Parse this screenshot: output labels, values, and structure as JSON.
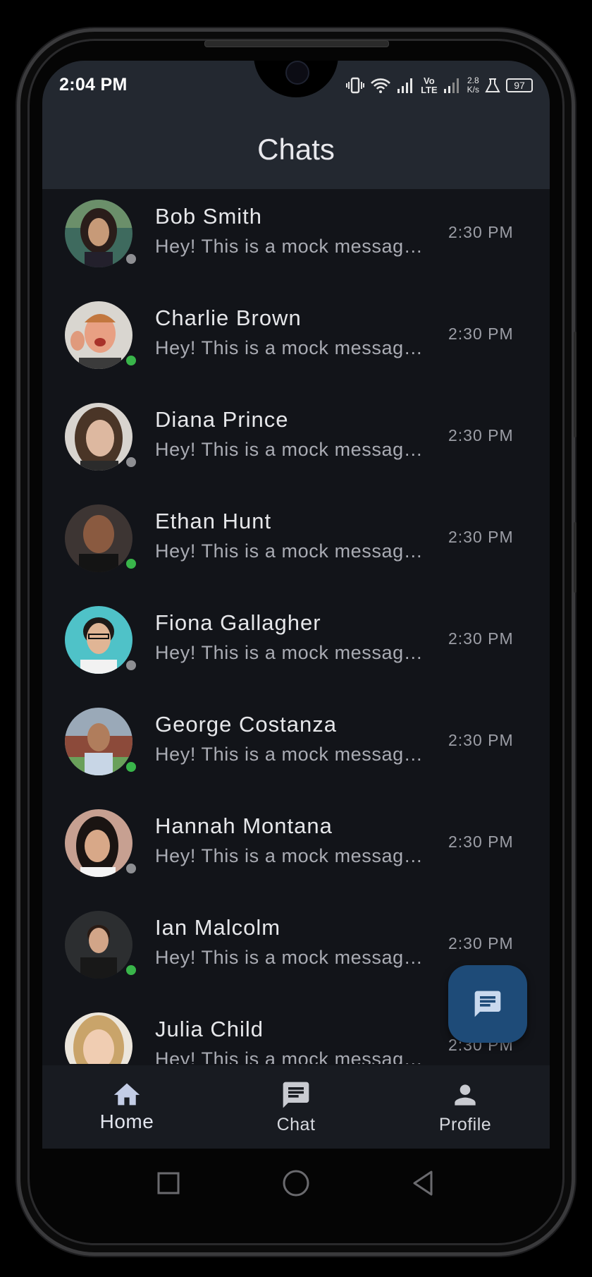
{
  "status_bar": {
    "time": "2:04 PM",
    "net_speed_value": "2.8",
    "net_speed_unit": "K/s",
    "volte_top": "Vo",
    "volte_bottom": "LTE",
    "battery": "97"
  },
  "header": {
    "title": "Chats"
  },
  "chats": [
    {
      "name": "Bob Smith",
      "preview": "Hey! This is a mock message from this user.",
      "time": "2:30 PM",
      "online": false
    },
    {
      "name": "Charlie Brown",
      "preview": "Hey! This is a mock message from this user.",
      "time": "2:30 PM",
      "online": true
    },
    {
      "name": "Diana Prince",
      "preview": "Hey! This is a mock message from this user.",
      "time": "2:30 PM",
      "online": false
    },
    {
      "name": "Ethan Hunt",
      "preview": "Hey! This is a mock message from this user.",
      "time": "2:30 PM",
      "online": true
    },
    {
      "name": "Fiona Gallagher",
      "preview": "Hey! This is a mock message from this user.",
      "time": "2:30 PM",
      "online": false
    },
    {
      "name": "George Costanza",
      "preview": "Hey! This is a mock message from this user.",
      "time": "2:30 PM",
      "online": true
    },
    {
      "name": "Hannah Montana",
      "preview": "Hey! This is a mock message from this user.",
      "time": "2:30 PM",
      "online": false
    },
    {
      "name": "Ian Malcolm",
      "preview": "Hey! This is a mock message from this user.",
      "time": "2:30 PM",
      "online": true
    },
    {
      "name": "Julia Child",
      "preview": "Hey! This is a mock message from this user.",
      "time": "2:30 PM",
      "online": false
    }
  ],
  "fab": {
    "icon": "message-icon"
  },
  "bottom_nav": {
    "home": "Home",
    "chat": "Chat",
    "profile": "Profile",
    "active": "home"
  },
  "colors": {
    "header_bg": "#232830",
    "list_bg": "#121419",
    "fab_bg": "#1e4b78",
    "online": "#39b54a",
    "offline": "#8e8f93"
  }
}
